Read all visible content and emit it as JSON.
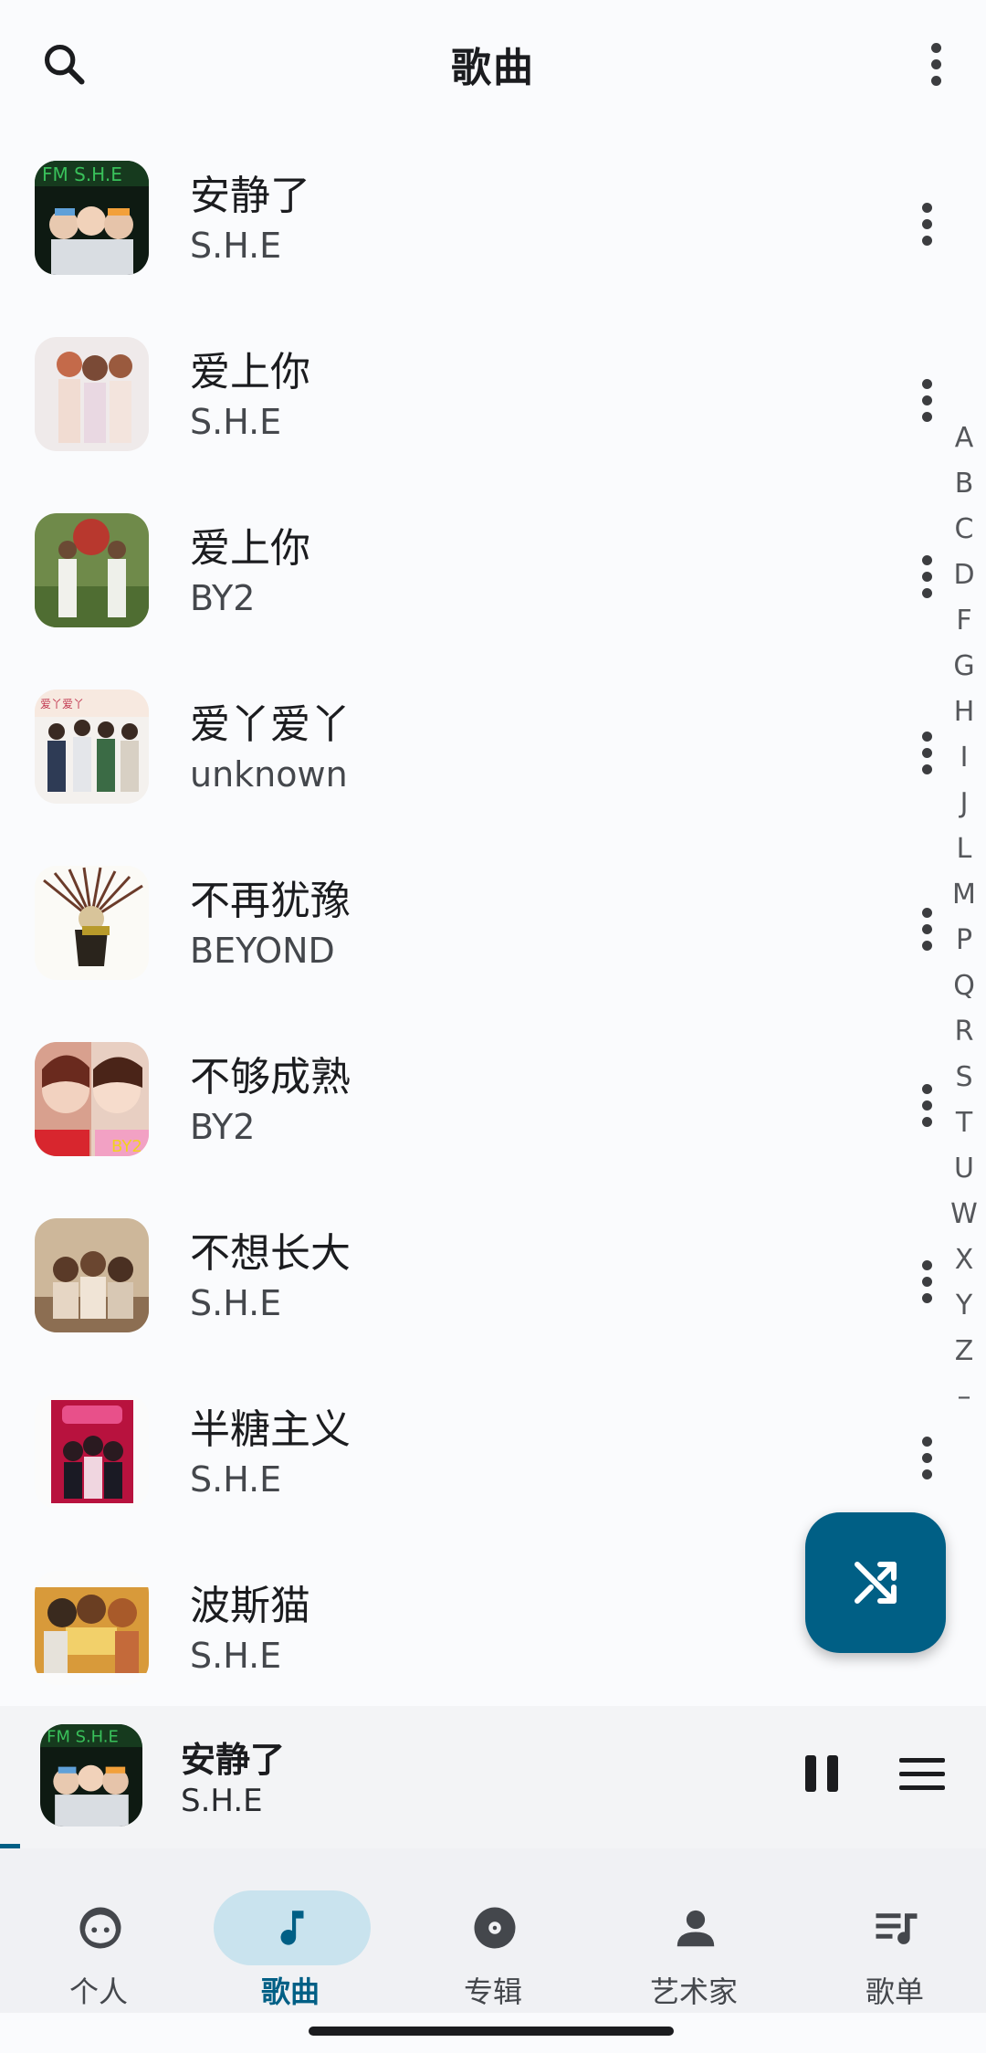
{
  "topbar": {
    "title": "歌曲",
    "search_icon": "search-icon",
    "overflow_icon": "more-vert-icon"
  },
  "songs": [
    {
      "title": "安静了",
      "artist": "S.H.E"
    },
    {
      "title": "爱上你",
      "artist": "S.H.E"
    },
    {
      "title": "爱上你",
      "artist": "BY2"
    },
    {
      "title": "爱丫爱丫",
      "artist": "unknown"
    },
    {
      "title": "不再犹豫",
      "artist": "BEYOND"
    },
    {
      "title": "不够成熟",
      "artist": "BY2"
    },
    {
      "title": "不想长大",
      "artist": "S.H.E"
    },
    {
      "title": "半糖主义",
      "artist": "S.H.E"
    },
    {
      "title": "波斯猫",
      "artist": "S.H.E"
    }
  ],
  "alphabet_index": [
    "A",
    "B",
    "C",
    "D",
    "F",
    "G",
    "H",
    "I",
    "J",
    "L",
    "M",
    "P",
    "Q",
    "R",
    "S",
    "T",
    "U",
    "W",
    "X",
    "Y",
    "Z",
    "–"
  ],
  "fab": {
    "icon": "shuffle-icon"
  },
  "now_playing": {
    "title": "安静了",
    "artist": "S.H.E",
    "progress_percent": 2
  },
  "bottom_nav": [
    {
      "label": "个人",
      "icon": "face-icon",
      "active": false
    },
    {
      "label": "歌曲",
      "icon": "music-note-icon",
      "active": true
    },
    {
      "label": "专辑",
      "icon": "album-icon",
      "active": false
    },
    {
      "label": "艺术家",
      "icon": "person-icon",
      "active": false
    },
    {
      "label": "歌单",
      "icon": "playlist-icon",
      "active": false
    }
  ],
  "colors": {
    "accent": "#005f85",
    "nav_active_pill": "#c9e3ee",
    "background": "#fafbfd"
  }
}
